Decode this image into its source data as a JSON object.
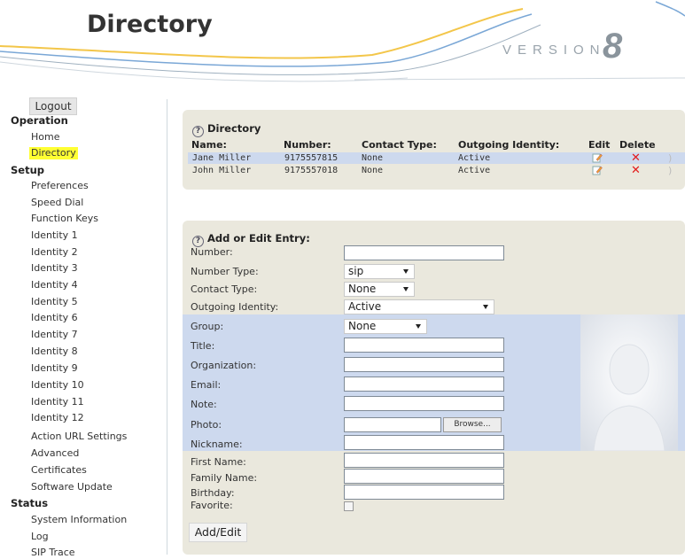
{
  "header": {
    "title": "Directory",
    "version_label": "VERSION",
    "version_number": "8"
  },
  "sidebar": {
    "logout": "Logout",
    "sections": [
      {
        "title": "Operation",
        "items": [
          "Home",
          "Directory"
        ]
      },
      {
        "title": "Setup",
        "items": [
          "Preferences",
          "Speed Dial",
          "Function Keys",
          "Identity 1",
          "Identity 2",
          "Identity 3",
          "Identity 4",
          "Identity 5",
          "Identity 6",
          "Identity 7",
          "Identity 8",
          "Identity 9",
          "Identity 10",
          "Identity 11",
          "Identity 12",
          "Action URL Settings",
          "Advanced",
          "Certificates",
          "Software Update"
        ]
      },
      {
        "title": "Status",
        "items": [
          "System Information",
          "Log",
          "SIP Trace"
        ]
      }
    ],
    "active_item": "Directory"
  },
  "directory_panel": {
    "title": "Directory",
    "columns": [
      "Name:",
      "Number:",
      "Contact Type:",
      "Outgoing Identity:",
      "Edit",
      "Delete"
    ],
    "rows": [
      {
        "name": "Jane Miller",
        "number": "9175557815",
        "contact_type": "None",
        "outgoing_identity": "Active"
      },
      {
        "name": "John Miller",
        "number": "9175557018",
        "contact_type": "None",
        "outgoing_identity": "Active"
      }
    ]
  },
  "form": {
    "title": "Add or Edit Entry:",
    "labels": {
      "number": "Number:",
      "number_type": "Number Type:",
      "contact_type": "Contact Type:",
      "outgoing_identity": "Outgoing Identity:",
      "group": "Group:",
      "title": "Title:",
      "organization": "Organization:",
      "email": "Email:",
      "note": "Note:",
      "photo": "Photo:",
      "nickname": "Nickname:",
      "first_name": "First Name:",
      "family_name": "Family Name:",
      "birthday": "Birthday:",
      "favorite": "Favorite:"
    },
    "values": {
      "number_type": "sip",
      "contact_type": "None",
      "outgoing_identity": "Active",
      "group": "None"
    },
    "browse_label": "Browse...",
    "submit_label": "Add/Edit"
  },
  "colors": {
    "panel_bg": "#eae8dd",
    "highlight_row": "#cdd9ee",
    "active_nav": "#ffff33",
    "delete_red": "#e31b1b"
  }
}
